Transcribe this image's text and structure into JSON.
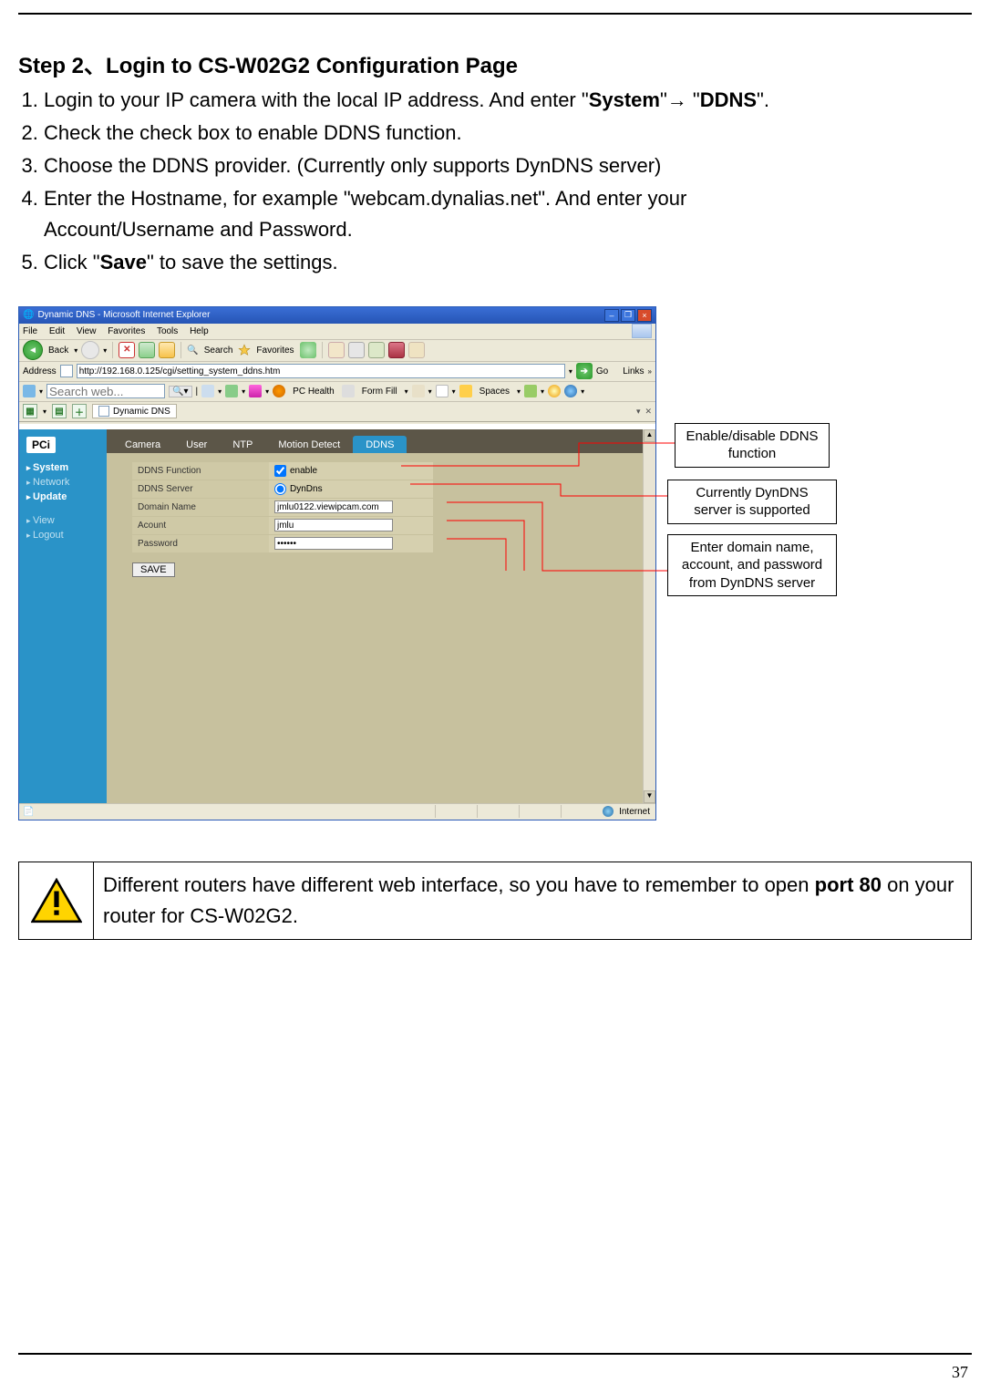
{
  "page_number": "37",
  "heading_prefix": "Step 2",
  "heading_sep": "、",
  "heading_rest": "Login to CS-W02G2 Configuration Page",
  "steps": {
    "s1a": "Login to your IP camera with the local IP address. And enter \"",
    "s1b1": "System",
    "s1c": "\"→ \"",
    "s1b2": "DDNS",
    "s1d": "\".",
    "s2": "Check the check box to enable DDNS function.",
    "s3": "Choose the DDNS provider. (Currently only supports DynDNS server)",
    "s4a": "Enter the Hostname, for example \"webcam.dynalias.net\". And enter your",
    "s4b": "Account/Username and Password.",
    "s5a": "Click \"",
    "s5b1": "Save",
    "s5c": "\" to save the settings."
  },
  "ie": {
    "title": "Dynamic DNS - Microsoft Internet Explorer",
    "menu": {
      "file": "File",
      "edit": "Edit",
      "view": "View",
      "fav": "Favorites",
      "tools": "Tools",
      "help": "Help"
    },
    "tb": {
      "back": "Back",
      "search": "Search",
      "favorites": "Favorites"
    },
    "addr_label": "Address",
    "url": "http://192.168.0.125/cgi/setting_system_ddns.htm",
    "go": "Go",
    "links": "Links",
    "ybar": {
      "search_ph": "Search web...",
      "pchealth": "PC Health",
      "formfill": "Form Fill",
      "spaces": "Spaces"
    },
    "tabbar": {
      "tab": "Dynamic DNS"
    },
    "status": "Internet"
  },
  "cam": {
    "logo": "PCi",
    "side": {
      "system": "System",
      "network": "Network",
      "update": "Update",
      "view": "View",
      "logout": "Logout"
    },
    "tabs": {
      "camera": "Camera",
      "user": "User",
      "ntp": "NTP",
      "motion": "Motion Detect",
      "ddns": "DDNS"
    },
    "rows": {
      "func_lab": "DDNS Function",
      "func_val": "enable",
      "server_lab": "DDNS Server",
      "server_val": "DynDns",
      "domain_lab": "Domain Name",
      "domain_val": "jmlu0122.viewipcam.com",
      "account_lab": "Acount",
      "account_val": "jmlu",
      "password_lab": "Password",
      "password_val": "••••••"
    },
    "save": "SAVE"
  },
  "callouts": {
    "c1": "Enable/disable DDNS function",
    "c2": "Currently DynDNS server is supported",
    "c3": "Enter domain name, account, and password from DynDNS server"
  },
  "note": {
    "t1": "Different routers have different web interface, so you have to remember to open ",
    "b": "port 80",
    "t2": " on your router for CS-W02G2."
  }
}
